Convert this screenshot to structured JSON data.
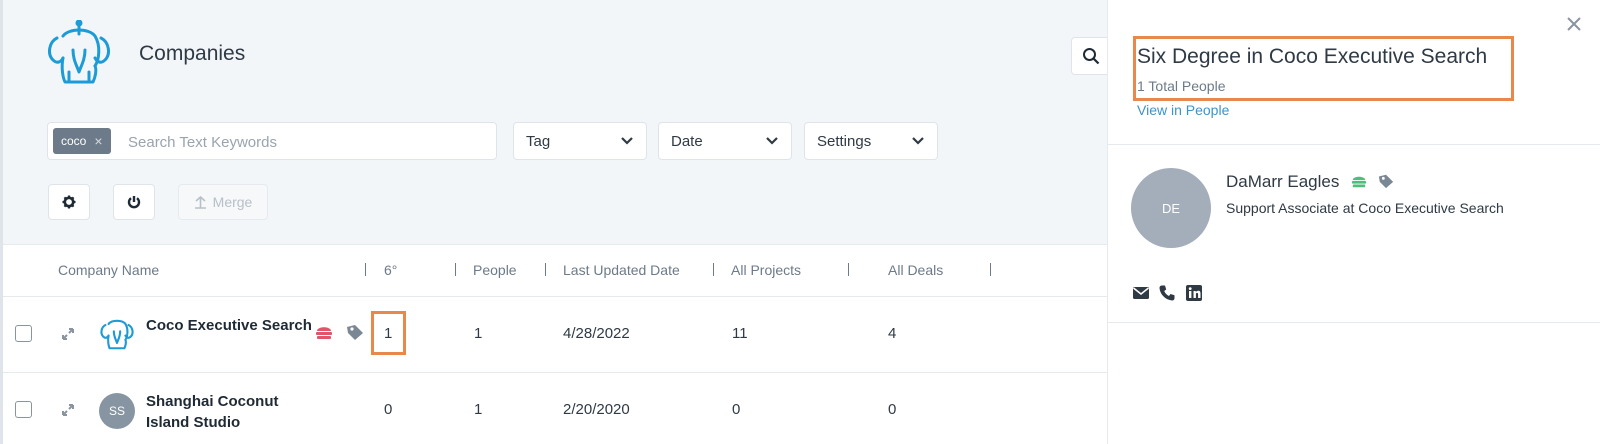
{
  "header": {
    "title": "Companies",
    "search_toggle_icon": "search-icon"
  },
  "filters": {
    "chip_label": "coco",
    "search_placeholder": "Search Text Keywords",
    "dropdowns": {
      "tag": "Tag",
      "date": "Date",
      "settings": "Settings"
    }
  },
  "toolbar": {
    "merge_label": "Merge"
  },
  "table": {
    "columns": [
      "Company Name",
      "6°",
      "People",
      "Last Updated Date",
      "All Projects",
      "All Deals"
    ],
    "rows": [
      {
        "name": "Coco Executive Search",
        "six_degree": "1",
        "people": "1",
        "last_updated": "4/28/2022",
        "projects": "11",
        "deals": "4"
      },
      {
        "name": "Shanghai Coconut Island Studio",
        "avatar": "SS",
        "six_degree": "0",
        "people": "1",
        "last_updated": "2/20/2020",
        "projects": "0",
        "deals": "0"
      }
    ]
  },
  "panel": {
    "title": "Six Degree in Coco Executive Search",
    "count": "1 Total People",
    "link": "View in People",
    "person": {
      "initials": "DE",
      "name": "DaMarr Eagles",
      "title": "Support Associate at Coco Executive Search"
    }
  },
  "colors": {
    "accent": "#3f93c8",
    "highlight": "#e8884c",
    "red_badge": "#e0556a",
    "green_badge": "#4cbf7a"
  }
}
